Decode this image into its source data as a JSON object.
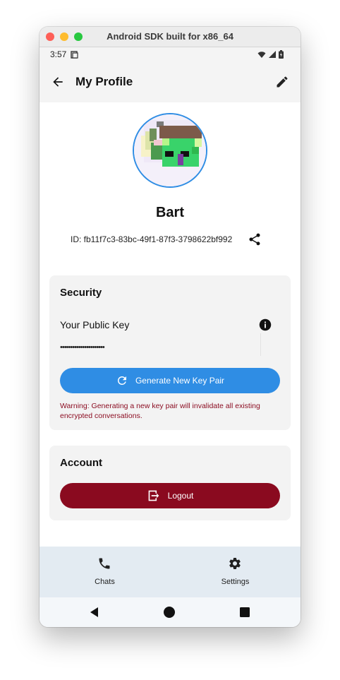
{
  "window": {
    "title": "Android SDK built for x86_64"
  },
  "status_bar": {
    "time": "3:57"
  },
  "app_bar": {
    "title": "My Profile"
  },
  "profile": {
    "name": "Bart",
    "id_text": "ID: fb11f7c3-83bc-49f1-87f3-3798622bf992"
  },
  "security": {
    "title": "Security",
    "public_key_label": "Your Public Key",
    "public_key_masked": "••••••••••••••••••••••",
    "generate_button": "Generate New Key Pair",
    "warning": "Warning: Generating a new key pair will invalidate all existing encrypted conversations."
  },
  "account": {
    "title": "Account",
    "logout_button": "Logout"
  },
  "bottom_nav": {
    "items": [
      {
        "label": "Chats",
        "icon": "phone-icon"
      },
      {
        "label": "Settings",
        "icon": "gear-icon"
      }
    ]
  },
  "colors": {
    "primary": "#2f8de4",
    "danger": "#8a0a1f",
    "card_bg": "#f3f3f3",
    "nav_bg": "#e3ebf2"
  }
}
